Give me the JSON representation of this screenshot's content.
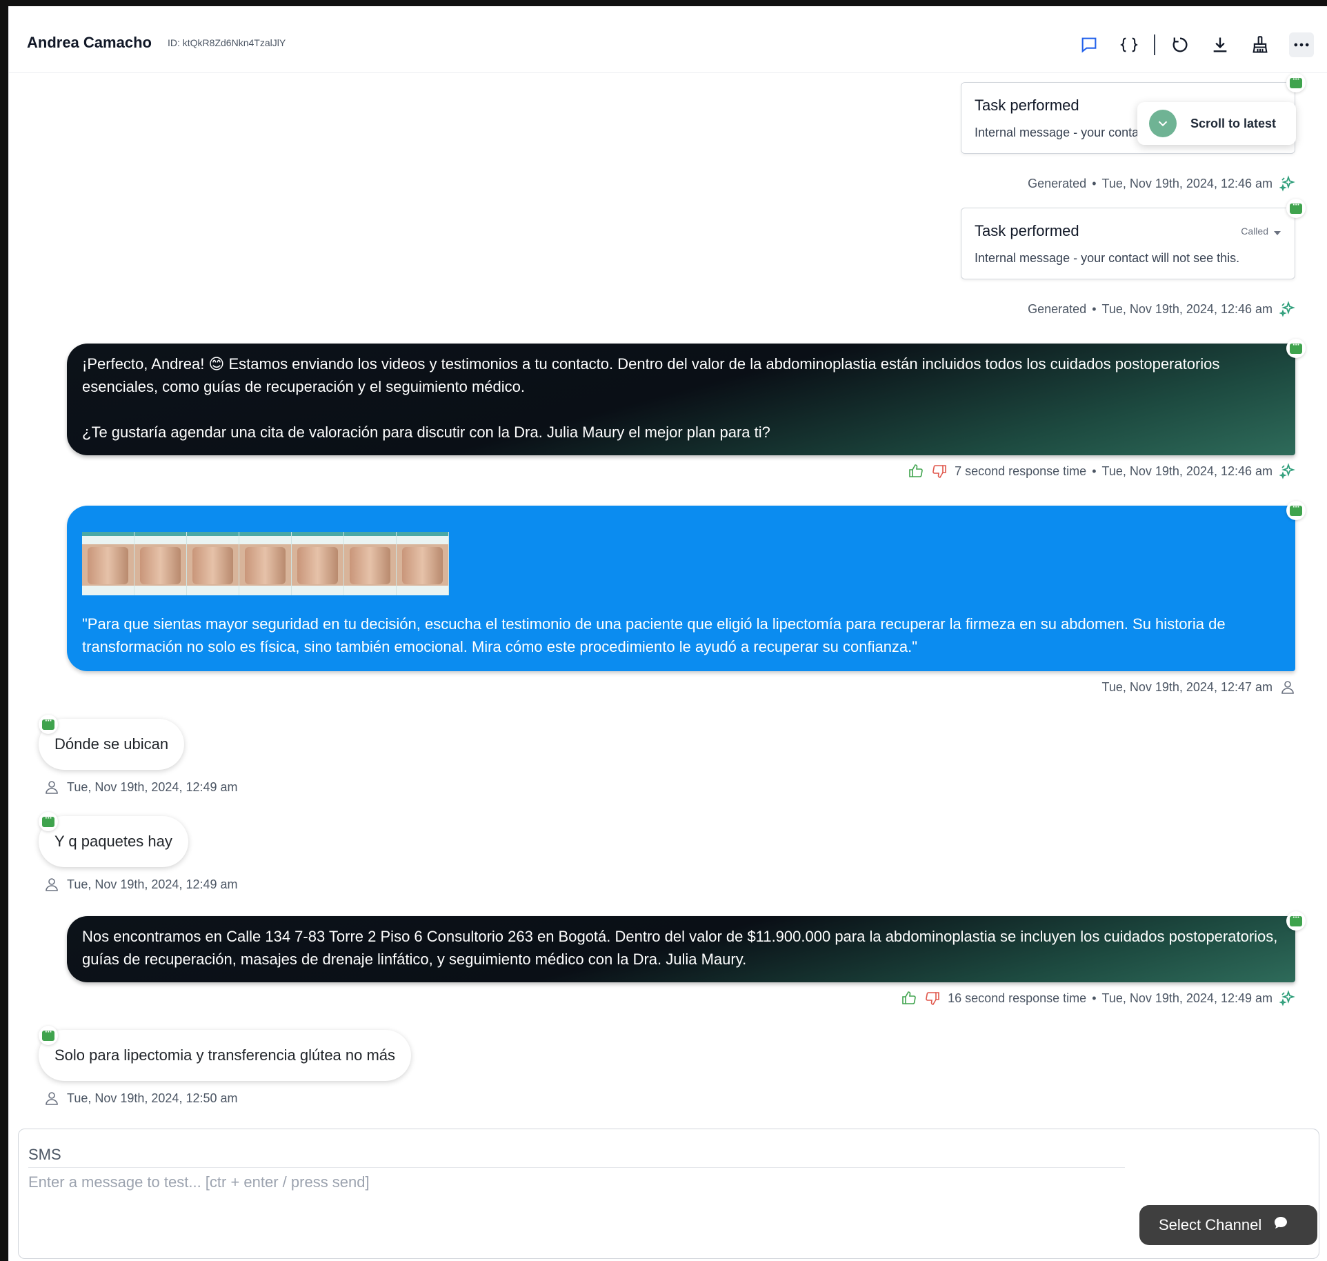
{
  "header": {
    "contact_name": "Andrea Camacho",
    "contact_id": "ID: ktQkR8Zd6Nkn4TzalJlY",
    "icons": [
      "chat-icon",
      "code-braces-icon",
      "refresh-icon",
      "download-icon",
      "broom-icon",
      "more-icon"
    ]
  },
  "scroll_to_latest": "Scroll to latest",
  "tasks": [
    {
      "title": "Task performed",
      "subtitle": "Internal message - your contact will not see this.",
      "status": "",
      "meta_label": "Generated",
      "timestamp": "Tue, Nov 19th, 2024, 12:46 am"
    },
    {
      "title": "Task performed",
      "subtitle": "Internal message - your contact will not see this.",
      "status": "Called",
      "meta_label": "Generated",
      "timestamp": "Tue, Nov 19th, 2024, 12:46 am"
    }
  ],
  "ai_messages": [
    {
      "line1": "¡Perfecto, Andrea! 😊 Estamos enviando los videos y testimonios a tu contacto. Dentro del valor de la abdominoplastia están incluidos todos los cuidados postoperatorios esenciales, como guías de recuperación y el seguimiento médico.",
      "line2": "¿Te gustaría agendar una cita de valoración para discutir con la Dra. Julia Maury el mejor plan para ti?",
      "response_time": "7 second response time",
      "timestamp": "Tue, Nov 19th, 2024, 12:46 am"
    },
    {
      "line1": "Nos encontramos en Calle 134 7-83 Torre 2 Piso 6 Consultorio 263 en Bogotá. Dentro del valor de $11.900.000 para la abdominoplastia se incluyen los cuidados postoperatorios, guías de recuperación, masajes de drenaje linfático, y seguimiento médico con la Dra. Julia Maury.",
      "response_time": "16 second response time",
      "timestamp": "Tue, Nov 19th, 2024, 12:49 am"
    }
  ],
  "media_message": {
    "text": "\"Para que sientas mayor seguridad en tu decisión, escucha el testimonio de una paciente que eligió la lipectomía para recuperar la firmeza en su abdomen. Su historia de transformación no solo es física, sino también emocional. Mira cómo este procedimiento le ayudó a recuperar su confianza.\"",
    "timestamp": "Tue, Nov 19th, 2024, 12:47 am"
  },
  "user_messages": [
    {
      "text": "Dónde se ubican",
      "timestamp": "Tue, Nov 19th, 2024, 12:49 am"
    },
    {
      "text": "Y q paquetes hay",
      "timestamp": "Tue, Nov 19th, 2024, 12:49 am"
    },
    {
      "text": "Solo para lipectomia y transferencia glútea no más",
      "timestamp": "Tue, Nov 19th, 2024, 12:50 am"
    }
  ],
  "composer": {
    "channel_label": "SMS",
    "placeholder": "Enter a message to test... [ctr + enter / press send]",
    "select_channel": "Select Channel"
  },
  "colors": {
    "media_bubble": "#0b8cf0",
    "channel_badge": "#3fa34d",
    "ai_icon": "#2e9e7a",
    "thumb_up": "#3fa34d",
    "thumb_down": "#e0564b"
  }
}
